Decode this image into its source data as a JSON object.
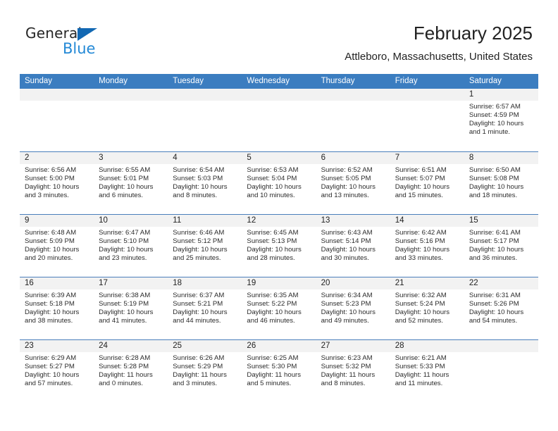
{
  "logo": {
    "word_one": "General",
    "word_two": "Blue",
    "triangle_color": "#1268b3",
    "blue_color": "#2489d6"
  },
  "header": {
    "title": "February 2025",
    "subtitle": "Attleboro, Massachusetts, United States"
  },
  "colors": {
    "header_blue": "#3b7dc0",
    "row_divider": "#4a7ebb",
    "day_band": "#f2f2f2"
  },
  "weekdays": [
    "Sunday",
    "Monday",
    "Tuesday",
    "Wednesday",
    "Thursday",
    "Friday",
    "Saturday"
  ],
  "weeks": [
    [
      {
        "day": "",
        "sunrise": "",
        "sunset": "",
        "daylight": "",
        "daylight2": ""
      },
      {
        "day": "",
        "sunrise": "",
        "sunset": "",
        "daylight": "",
        "daylight2": ""
      },
      {
        "day": "",
        "sunrise": "",
        "sunset": "",
        "daylight": "",
        "daylight2": ""
      },
      {
        "day": "",
        "sunrise": "",
        "sunset": "",
        "daylight": "",
        "daylight2": ""
      },
      {
        "day": "",
        "sunrise": "",
        "sunset": "",
        "daylight": "",
        "daylight2": ""
      },
      {
        "day": "",
        "sunrise": "",
        "sunset": "",
        "daylight": "",
        "daylight2": ""
      },
      {
        "day": "1",
        "sunrise": "Sunrise: 6:57 AM",
        "sunset": "Sunset: 4:59 PM",
        "daylight": "Daylight: 10 hours",
        "daylight2": "and 1 minute."
      }
    ],
    [
      {
        "day": "2",
        "sunrise": "Sunrise: 6:56 AM",
        "sunset": "Sunset: 5:00 PM",
        "daylight": "Daylight: 10 hours",
        "daylight2": "and 3 minutes."
      },
      {
        "day": "3",
        "sunrise": "Sunrise: 6:55 AM",
        "sunset": "Sunset: 5:01 PM",
        "daylight": "Daylight: 10 hours",
        "daylight2": "and 6 minutes."
      },
      {
        "day": "4",
        "sunrise": "Sunrise: 6:54 AM",
        "sunset": "Sunset: 5:03 PM",
        "daylight": "Daylight: 10 hours",
        "daylight2": "and 8 minutes."
      },
      {
        "day": "5",
        "sunrise": "Sunrise: 6:53 AM",
        "sunset": "Sunset: 5:04 PM",
        "daylight": "Daylight: 10 hours",
        "daylight2": "and 10 minutes."
      },
      {
        "day": "6",
        "sunrise": "Sunrise: 6:52 AM",
        "sunset": "Sunset: 5:05 PM",
        "daylight": "Daylight: 10 hours",
        "daylight2": "and 13 minutes."
      },
      {
        "day": "7",
        "sunrise": "Sunrise: 6:51 AM",
        "sunset": "Sunset: 5:07 PM",
        "daylight": "Daylight: 10 hours",
        "daylight2": "and 15 minutes."
      },
      {
        "day": "8",
        "sunrise": "Sunrise: 6:50 AM",
        "sunset": "Sunset: 5:08 PM",
        "daylight": "Daylight: 10 hours",
        "daylight2": "and 18 minutes."
      }
    ],
    [
      {
        "day": "9",
        "sunrise": "Sunrise: 6:48 AM",
        "sunset": "Sunset: 5:09 PM",
        "daylight": "Daylight: 10 hours",
        "daylight2": "and 20 minutes."
      },
      {
        "day": "10",
        "sunrise": "Sunrise: 6:47 AM",
        "sunset": "Sunset: 5:10 PM",
        "daylight": "Daylight: 10 hours",
        "daylight2": "and 23 minutes."
      },
      {
        "day": "11",
        "sunrise": "Sunrise: 6:46 AM",
        "sunset": "Sunset: 5:12 PM",
        "daylight": "Daylight: 10 hours",
        "daylight2": "and 25 minutes."
      },
      {
        "day": "12",
        "sunrise": "Sunrise: 6:45 AM",
        "sunset": "Sunset: 5:13 PM",
        "daylight": "Daylight: 10 hours",
        "daylight2": "and 28 minutes."
      },
      {
        "day": "13",
        "sunrise": "Sunrise: 6:43 AM",
        "sunset": "Sunset: 5:14 PM",
        "daylight": "Daylight: 10 hours",
        "daylight2": "and 30 minutes."
      },
      {
        "day": "14",
        "sunrise": "Sunrise: 6:42 AM",
        "sunset": "Sunset: 5:16 PM",
        "daylight": "Daylight: 10 hours",
        "daylight2": "and 33 minutes."
      },
      {
        "day": "15",
        "sunrise": "Sunrise: 6:41 AM",
        "sunset": "Sunset: 5:17 PM",
        "daylight": "Daylight: 10 hours",
        "daylight2": "and 36 minutes."
      }
    ],
    [
      {
        "day": "16",
        "sunrise": "Sunrise: 6:39 AM",
        "sunset": "Sunset: 5:18 PM",
        "daylight": "Daylight: 10 hours",
        "daylight2": "and 38 minutes."
      },
      {
        "day": "17",
        "sunrise": "Sunrise: 6:38 AM",
        "sunset": "Sunset: 5:19 PM",
        "daylight": "Daylight: 10 hours",
        "daylight2": "and 41 minutes."
      },
      {
        "day": "18",
        "sunrise": "Sunrise: 6:37 AM",
        "sunset": "Sunset: 5:21 PM",
        "daylight": "Daylight: 10 hours",
        "daylight2": "and 44 minutes."
      },
      {
        "day": "19",
        "sunrise": "Sunrise: 6:35 AM",
        "sunset": "Sunset: 5:22 PM",
        "daylight": "Daylight: 10 hours",
        "daylight2": "and 46 minutes."
      },
      {
        "day": "20",
        "sunrise": "Sunrise: 6:34 AM",
        "sunset": "Sunset: 5:23 PM",
        "daylight": "Daylight: 10 hours",
        "daylight2": "and 49 minutes."
      },
      {
        "day": "21",
        "sunrise": "Sunrise: 6:32 AM",
        "sunset": "Sunset: 5:24 PM",
        "daylight": "Daylight: 10 hours",
        "daylight2": "and 52 minutes."
      },
      {
        "day": "22",
        "sunrise": "Sunrise: 6:31 AM",
        "sunset": "Sunset: 5:26 PM",
        "daylight": "Daylight: 10 hours",
        "daylight2": "and 54 minutes."
      }
    ],
    [
      {
        "day": "23",
        "sunrise": "Sunrise: 6:29 AM",
        "sunset": "Sunset: 5:27 PM",
        "daylight": "Daylight: 10 hours",
        "daylight2": "and 57 minutes."
      },
      {
        "day": "24",
        "sunrise": "Sunrise: 6:28 AM",
        "sunset": "Sunset: 5:28 PM",
        "daylight": "Daylight: 11 hours",
        "daylight2": "and 0 minutes."
      },
      {
        "day": "25",
        "sunrise": "Sunrise: 6:26 AM",
        "sunset": "Sunset: 5:29 PM",
        "daylight": "Daylight: 11 hours",
        "daylight2": "and 3 minutes."
      },
      {
        "day": "26",
        "sunrise": "Sunrise: 6:25 AM",
        "sunset": "Sunset: 5:30 PM",
        "daylight": "Daylight: 11 hours",
        "daylight2": "and 5 minutes."
      },
      {
        "day": "27",
        "sunrise": "Sunrise: 6:23 AM",
        "sunset": "Sunset: 5:32 PM",
        "daylight": "Daylight: 11 hours",
        "daylight2": "and 8 minutes."
      },
      {
        "day": "28",
        "sunrise": "Sunrise: 6:21 AM",
        "sunset": "Sunset: 5:33 PM",
        "daylight": "Daylight: 11 hours",
        "daylight2": "and 11 minutes."
      },
      {
        "day": "",
        "sunrise": "",
        "sunset": "",
        "daylight": "",
        "daylight2": ""
      }
    ]
  ]
}
